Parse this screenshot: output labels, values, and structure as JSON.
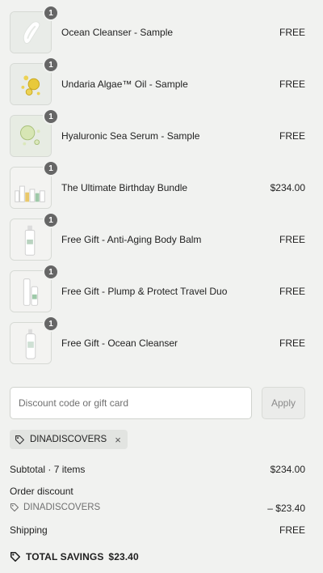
{
  "items": [
    {
      "name": "Ocean Cleanser - Sample",
      "price": "FREE",
      "qty": "1",
      "icon": "cream-swatch-icon"
    },
    {
      "name": "Undaria Algae™ Oil - Sample",
      "price": "FREE",
      "qty": "1",
      "icon": "oil-drops-icon"
    },
    {
      "name": "Hyaluronic Sea Serum - Sample",
      "price": "FREE",
      "qty": "1",
      "icon": "serum-drops-icon"
    },
    {
      "name": "The Ultimate Birthday Bundle",
      "price": "$234.00",
      "qty": "1",
      "icon": "bundle-bottles-icon"
    },
    {
      "name": "Free Gift - Anti-Aging Body Balm",
      "price": "FREE",
      "qty": "1",
      "icon": "balm-bottle-icon"
    },
    {
      "name": "Free Gift - Plump & Protect Travel Duo",
      "price": "FREE",
      "qty": "1",
      "icon": "travel-duo-icon"
    },
    {
      "name": "Free Gift - Ocean Cleanser",
      "price": "FREE",
      "qty": "1",
      "icon": "cleanser-bottle-icon"
    }
  ],
  "discount": {
    "placeholder": "Discount code or gift card",
    "apply_label": "Apply",
    "applied_code": "DINADISCOVERS",
    "remove_symbol": "×"
  },
  "summary": {
    "subtotal_label": "Subtotal · 7 items",
    "subtotal_value": "$234.00",
    "order_discount_label": "Order discount",
    "discount_code": "DINADISCOVERS",
    "discount_value": "– $23.40",
    "shipping_label": "Shipping",
    "shipping_value": "FREE",
    "total_savings_label": "TOTAL SAVINGS",
    "total_savings_value": "$23.40"
  },
  "colors": {
    "background": "#f1f2f0",
    "badge": "#666666",
    "chip": "#e2e4e1"
  }
}
